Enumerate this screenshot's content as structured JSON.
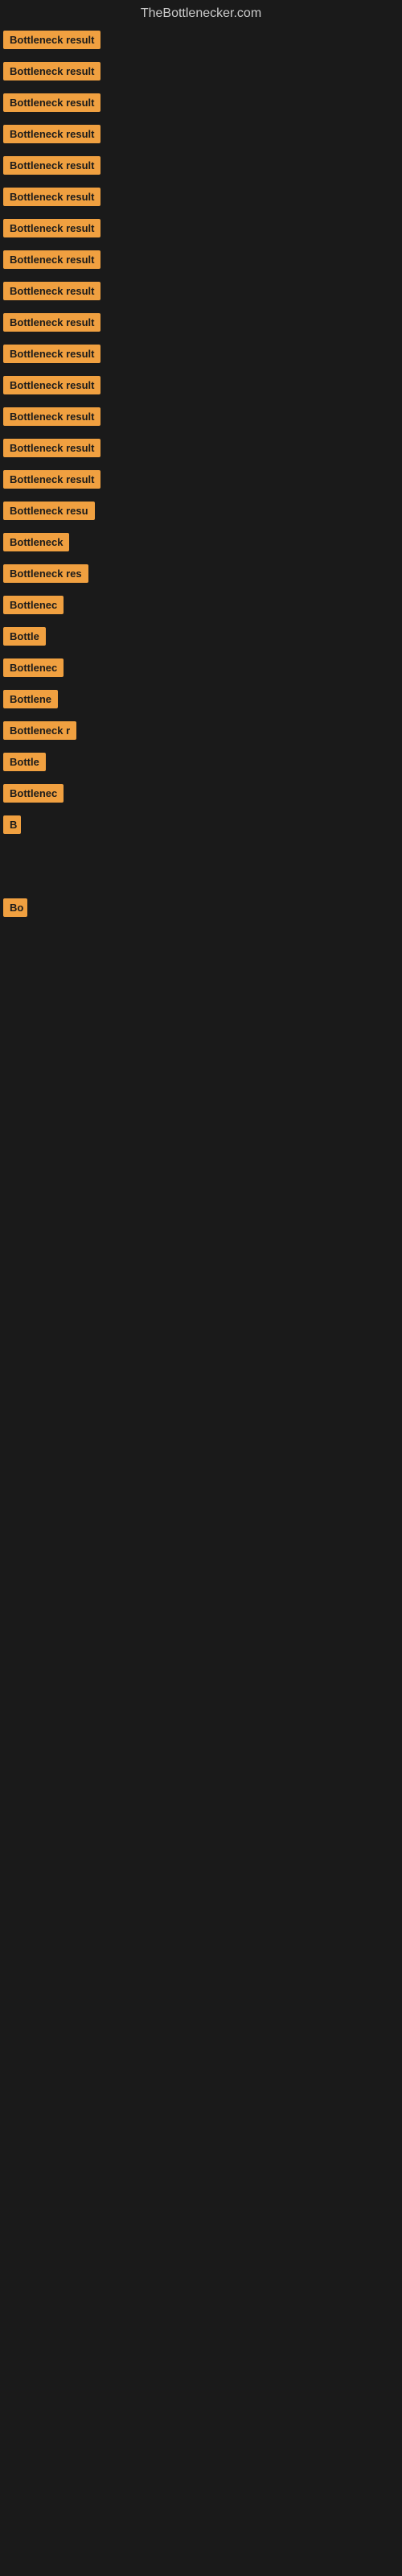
{
  "site": {
    "title": "TheBottlenecker.com"
  },
  "items": [
    {
      "label": "Bottleneck result",
      "width": 160
    },
    {
      "label": "Bottleneck result",
      "width": 160
    },
    {
      "label": "Bottleneck result",
      "width": 160
    },
    {
      "label": "Bottleneck result",
      "width": 160
    },
    {
      "label": "Bottleneck result",
      "width": 160
    },
    {
      "label": "Bottleneck result",
      "width": 160
    },
    {
      "label": "Bottleneck result",
      "width": 160
    },
    {
      "label": "Bottleneck result",
      "width": 160
    },
    {
      "label": "Bottleneck result",
      "width": 160
    },
    {
      "label": "Bottleneck result",
      "width": 160
    },
    {
      "label": "Bottleneck result",
      "width": 160
    },
    {
      "label": "Bottleneck result",
      "width": 160
    },
    {
      "label": "Bottleneck result",
      "width": 160
    },
    {
      "label": "Bottleneck result",
      "width": 160
    },
    {
      "label": "Bottleneck result",
      "width": 160
    },
    {
      "label": "Bottleneck resu",
      "width": 145
    },
    {
      "label": "Bottleneck",
      "width": 95
    },
    {
      "label": "Bottleneck res",
      "width": 130
    },
    {
      "label": "Bottlenec",
      "width": 88
    },
    {
      "label": "Bottle",
      "width": 68
    },
    {
      "label": "Bottlenec",
      "width": 88
    },
    {
      "label": "Bottlene",
      "width": 80
    },
    {
      "label": "Bottleneck r",
      "width": 108
    },
    {
      "label": "Bottle",
      "width": 68
    },
    {
      "label": "Bottlenec",
      "width": 88
    },
    {
      "label": "B",
      "width": 22
    },
    {
      "label": "",
      "width": 0
    },
    {
      "label": "",
      "width": 0
    },
    {
      "label": "",
      "width": 0
    },
    {
      "label": "",
      "width": 0
    },
    {
      "label": "Bo",
      "width": 30
    },
    {
      "label": "",
      "width": 0
    },
    {
      "label": "",
      "width": 0
    },
    {
      "label": "",
      "width": 0
    },
    {
      "label": "",
      "width": 0
    }
  ],
  "colors": {
    "background": "#1a1a1a",
    "badge": "#f0a040",
    "title": "#cccccc"
  }
}
